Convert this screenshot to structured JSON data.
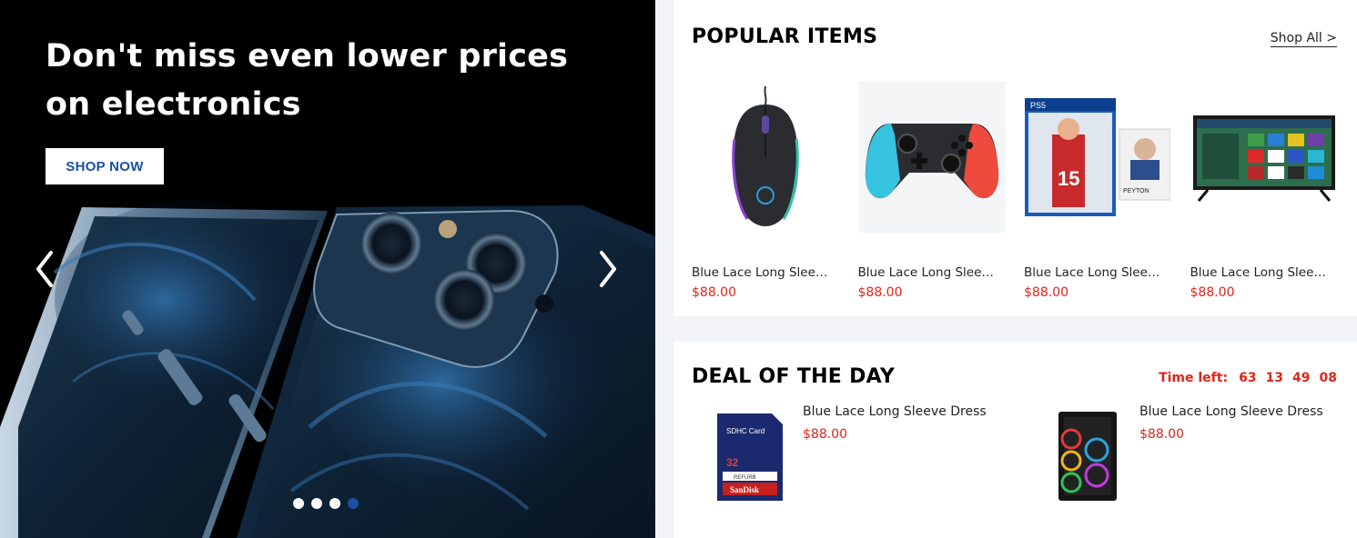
{
  "hero": {
    "title": "Don't miss even lower prices on electronics",
    "cta_label": "SHOP NOW",
    "slides_total": 4,
    "active_slide": 4
  },
  "popular": {
    "title": "POPULAR ITEMS",
    "shop_all": "Shop All >",
    "products": [
      {
        "name": "Blue Lace Long Sleeve Dress",
        "price": "$88.00",
        "image": "gaming-mouse"
      },
      {
        "name": "Blue Lace Long Sleeve Dress",
        "price": "$88.00",
        "image": "game-controller"
      },
      {
        "name": "Blue Lace Long Sleeve Dress",
        "price": "$88.00",
        "image": "video-game-cases"
      },
      {
        "name": "Blue Lace Long Sleeve Dress",
        "price": "$88.00",
        "image": "smart-tv"
      }
    ]
  },
  "deal": {
    "title": "DEAL OF THE DAY",
    "time_left_label": "Time left:",
    "timer": [
      "63",
      "13",
      "49",
      "08"
    ],
    "items": [
      {
        "name": "Blue Lace Long Sleeve Dress",
        "price": "$88.00",
        "image": "sd-card"
      },
      {
        "name": "Blue Lace Long Sleeve Dress",
        "price": "$88.00",
        "image": "pc-case"
      }
    ]
  },
  "colors": {
    "accent": "#1c4fa3",
    "price": "#e0251b",
    "hero_bg": "#000000"
  }
}
